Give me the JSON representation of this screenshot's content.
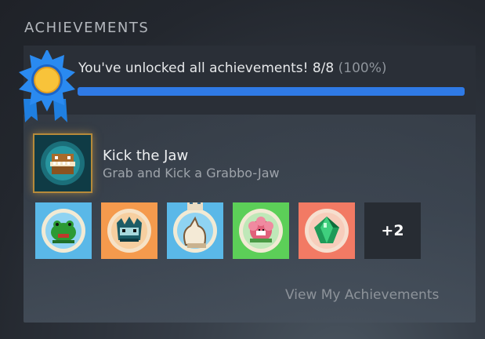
{
  "section": {
    "title": "ACHIEVEMENTS"
  },
  "summary": {
    "text": "You've unlocked all achievements! 8/8",
    "percent_text": "(100%)",
    "progress": 1.0,
    "progress_color": "#2f7ae5",
    "medal_icon": "medal-ribbon-icon"
  },
  "featured": {
    "title": "Kick the Jaw",
    "description": "Grab and Kick a Grabbo-Jaw",
    "icon": "grabbo-jaw-icon"
  },
  "achievements": [
    {
      "icon": "frog-icon",
      "color": "#5ab8e8"
    },
    {
      "icon": "spiky-creature-icon",
      "color": "#f59a4d"
    },
    {
      "icon": "claw-hand-icon",
      "color": "#5ab8e8"
    },
    {
      "icon": "flower-creature-icon",
      "color": "#5ccf58"
    },
    {
      "icon": "green-gem-icon",
      "color": "#f27a64"
    }
  ],
  "more": {
    "label": "+2"
  },
  "footer": {
    "link_label": "View My Achievements"
  }
}
